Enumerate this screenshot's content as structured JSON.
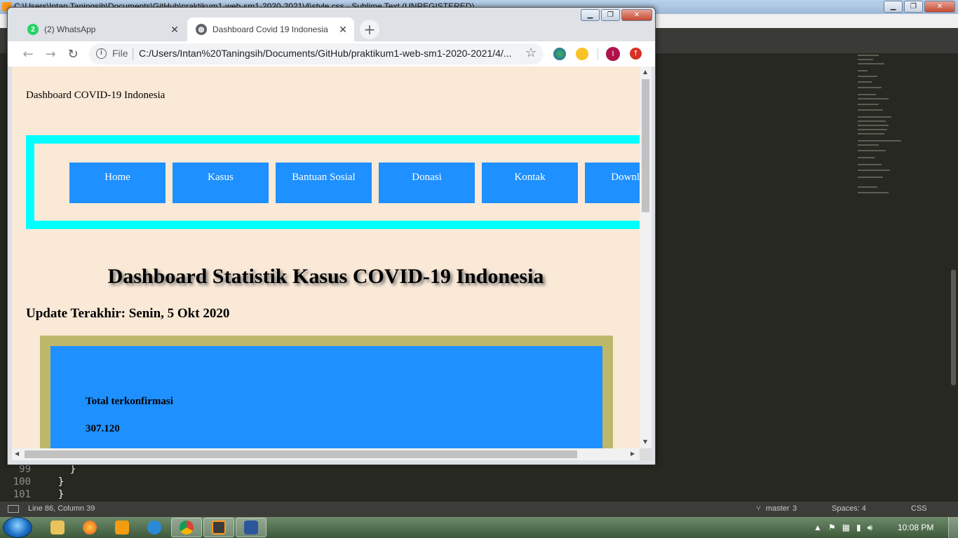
{
  "sublime": {
    "window_title": "C:\\Users\\Intan Taningsih\\Documents\\GitHub\\praktikum1-web-sm1-2020-2021\\4\\style.css - Sublime Text (UNREGISTERED)",
    "code_lines": [
      {
        "num": "99",
        "code": "    }"
      },
      {
        "num": "100",
        "code": "  }"
      },
      {
        "num": "101",
        "code": "  }"
      }
    ],
    "status": {
      "position": "Line 86, Column 39",
      "branch": "master",
      "branch_count": "3",
      "spaces": "Spaces: 4",
      "syntax": "CSS"
    }
  },
  "chrome": {
    "tabs": [
      {
        "label": "(2) WhatsApp",
        "badge": "2",
        "active": false
      },
      {
        "label": "Dashboard Covid 19 Indonesia",
        "active": true
      }
    ],
    "address": {
      "scheme_label": "File",
      "url": "C:/Users/Intan%20Taningsih/Documents/GitHub/praktikum1-web-sm1-2020-2021/4/..."
    },
    "profile_initial": "I"
  },
  "page": {
    "header": "Dashboard COVID-19 Indonesia",
    "nav": [
      "Home",
      "Kasus",
      "Bantuan Sosial",
      "Donasi",
      "Kontak",
      "Download"
    ],
    "title": "Dashboard Statistik Kasus COVID-19 Indonesia",
    "update": "Update Terakhir: Senin, 5 Okt 2020",
    "stat": {
      "label": "Total terkonfirmasi",
      "value": "307.120"
    }
  },
  "taskbar": {
    "clock": "10:08 PM"
  },
  "colors": {
    "page_bg": "#fae9d7",
    "nav_border": "#00ffff",
    "nav_button": "#1e90ff",
    "stat_border": "#bdb76b",
    "stat_box": "#1e90ff"
  }
}
